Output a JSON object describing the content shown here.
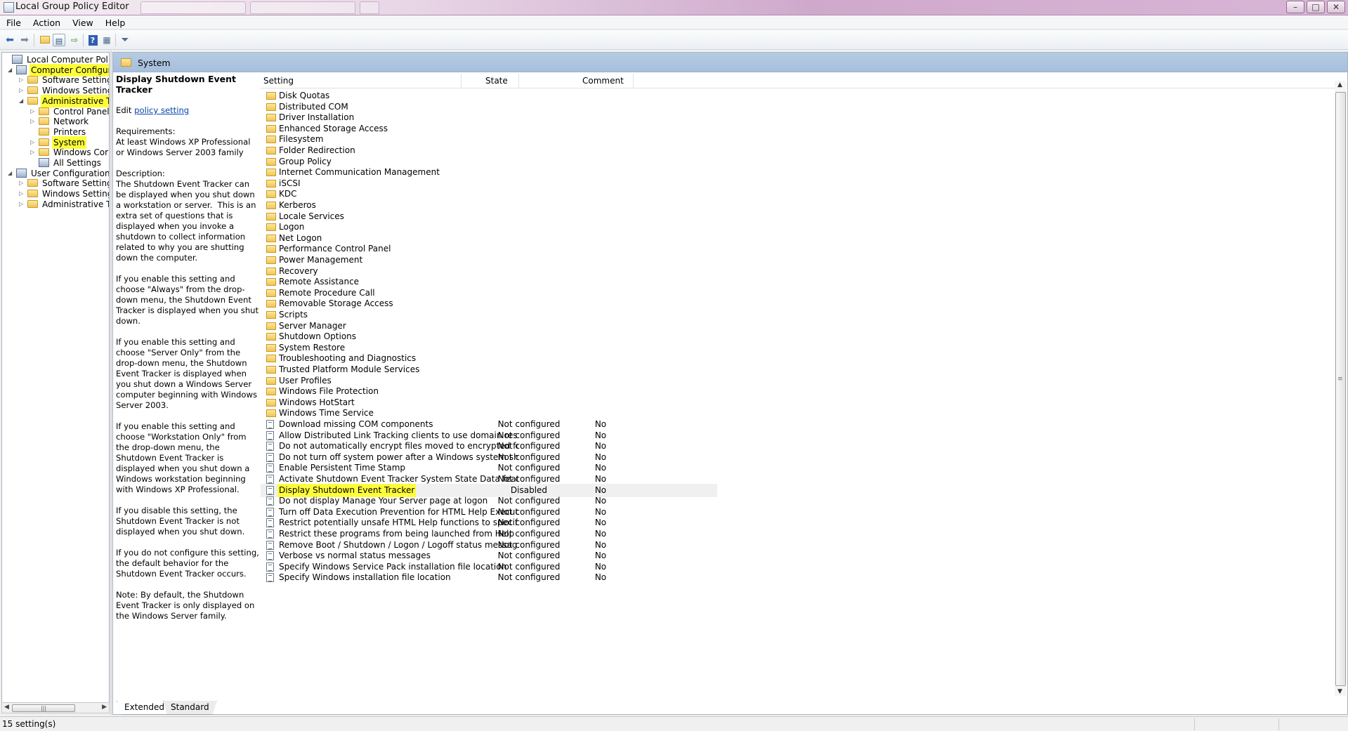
{
  "window": {
    "title": "Local Group Policy Editor",
    "controls": {
      "minimize": "–",
      "maximize": "□",
      "close": "✕"
    }
  },
  "menu": [
    "File",
    "Action",
    "View",
    "Help"
  ],
  "toolbar": {
    "icons": [
      "back-arrow-icon",
      "forward-arrow-icon",
      "up-folder-icon",
      "show-hide-tree-icon",
      "export-list-icon",
      "help-icon",
      "extended-view-icon",
      "filter-icon"
    ]
  },
  "tree": {
    "items": [
      {
        "label": "Local Computer Policy",
        "level": 0,
        "icon": "policy-icon",
        "twisty": "",
        "highlight": false
      },
      {
        "label": "Computer Configura",
        "level": 1,
        "icon": "computer-icon",
        "twisty": "◢",
        "highlight": true
      },
      {
        "label": "Software Settings",
        "level": 2,
        "icon": "folder-icon",
        "twisty": "▷",
        "highlight": false
      },
      {
        "label": "Windows Setting",
        "level": 2,
        "icon": "folder-icon",
        "twisty": "▷",
        "highlight": false
      },
      {
        "label": "Administrative Te",
        "level": 2,
        "icon": "folder-icon",
        "twisty": "◢",
        "highlight": true
      },
      {
        "label": "Control Panel",
        "level": 3,
        "icon": "folder-icon",
        "twisty": "▷",
        "highlight": false
      },
      {
        "label": "Network",
        "level": 3,
        "icon": "folder-icon",
        "twisty": "▷",
        "highlight": false
      },
      {
        "label": "Printers",
        "level": 3,
        "icon": "folder-icon",
        "twisty": "",
        "highlight": false
      },
      {
        "label": "System",
        "level": 3,
        "icon": "folder-icon",
        "twisty": "▷",
        "highlight": true
      },
      {
        "label": "Windows Cor",
        "level": 3,
        "icon": "folder-icon",
        "twisty": "▷",
        "highlight": false
      },
      {
        "label": "All Settings",
        "level": 3,
        "icon": "all-settings-icon",
        "twisty": "",
        "highlight": false
      },
      {
        "label": "User Configuration",
        "level": 1,
        "icon": "user-icon",
        "twisty": "◢",
        "highlight": false
      },
      {
        "label": "Software Settings",
        "level": 2,
        "icon": "folder-icon",
        "twisty": "▷",
        "highlight": false
      },
      {
        "label": "Windows Setting",
        "level": 2,
        "icon": "folder-icon",
        "twisty": "▷",
        "highlight": false
      },
      {
        "label": "Administrative Te",
        "level": 2,
        "icon": "folder-icon",
        "twisty": "▷",
        "highlight": false
      }
    ]
  },
  "content": {
    "header": "System",
    "description": {
      "title": "Display Shutdown Event Tracker",
      "edit_prefix": "Edit ",
      "edit_link": "policy setting",
      "paragraphs": [
        "Requirements:\nAt least Windows XP Professional or Windows Server 2003 family",
        "Description:\nThe Shutdown Event Tracker can be displayed when you shut down a workstation or server.  This is an extra set of questions that is displayed when you invoke a shutdown to collect information related to why you are shutting down the computer.",
        "If you enable this setting and choose \"Always\" from the drop-down menu, the Shutdown Event Tracker is displayed when you shut down.",
        "If you enable this setting and choose \"Server Only\" from the drop-down menu, the Shutdown Event Tracker is displayed when you shut down a Windows Server computer beginning with Windows Server 2003.",
        "If you enable this setting and choose \"Workstation Only\" from the drop-down menu, the Shutdown Event Tracker is displayed when you shut down a Windows workstation beginning with Windows XP Professional.",
        "If you disable this setting, the Shutdown Event Tracker is not displayed when you shut down.",
        "If you do not configure this setting, the default behavior for the Shutdown Event Tracker occurs.",
        "Note: By default, the Shutdown Event Tracker is only displayed on the Windows Server family."
      ]
    },
    "columns": {
      "setting": "Setting",
      "state": "State",
      "comment": "Comment"
    },
    "folders": [
      "Disk Quotas",
      "Distributed COM",
      "Driver Installation",
      "Enhanced Storage Access",
      "Filesystem",
      "Folder Redirection",
      "Group Policy",
      "Internet Communication Management",
      "iSCSI",
      "KDC",
      "Kerberos",
      "Locale Services",
      "Logon",
      "Net Logon",
      "Performance Control Panel",
      "Power Management",
      "Recovery",
      "Remote Assistance",
      "Remote Procedure Call",
      "Removable Storage Access",
      "Scripts",
      "Server Manager",
      "Shutdown Options",
      "System Restore",
      "Troubleshooting and Diagnostics",
      "Trusted Platform Module Services",
      "User Profiles",
      "Windows File Protection",
      "Windows HotStart",
      "Windows Time Service"
    ],
    "settings": [
      {
        "name": "Download missing COM components",
        "state": "Not configured",
        "comment": "No",
        "selected": false
      },
      {
        "name": "Allow Distributed Link Tracking clients to use domain resour...",
        "state": "Not configured",
        "comment": "No",
        "selected": false
      },
      {
        "name": "Do not automatically encrypt files moved to encrypted fold...",
        "state": "Not configured",
        "comment": "No",
        "selected": false
      },
      {
        "name": "Do not turn off system power after a Windows system shutd...",
        "state": "Not configured",
        "comment": "No",
        "selected": false
      },
      {
        "name": "Enable Persistent Time Stamp",
        "state": "Not configured",
        "comment": "No",
        "selected": false
      },
      {
        "name": "Activate Shutdown Event Tracker System State Data feature",
        "state": "Not configured",
        "comment": "No",
        "selected": false
      },
      {
        "name": "Display Shutdown Event Tracker",
        "state": "Disabled",
        "comment": "No",
        "selected": true
      },
      {
        "name": "Do not display Manage Your Server page at logon",
        "state": "Not configured",
        "comment": "No",
        "selected": false
      },
      {
        "name": "Turn off Data Execution Prevention for HTML Help Executible",
        "state": "Not configured",
        "comment": "No",
        "selected": false
      },
      {
        "name": "Restrict potentially unsafe HTML Help functions to specified...",
        "state": "Not configured",
        "comment": "No",
        "selected": false
      },
      {
        "name": "Restrict these programs from being launched from Help",
        "state": "Not configured",
        "comment": "No",
        "selected": false
      },
      {
        "name": "Remove Boot / Shutdown / Logon / Logoff status messages",
        "state": "Not configured",
        "comment": "No",
        "selected": false
      },
      {
        "name": "Verbose vs normal status messages",
        "state": "Not configured",
        "comment": "No",
        "selected": false
      },
      {
        "name": "Specify Windows Service Pack installation file location",
        "state": "Not configured",
        "comment": "No",
        "selected": false
      },
      {
        "name": "Specify Windows installation file location",
        "state": "Not configured",
        "comment": "No",
        "selected": false
      }
    ]
  },
  "view_tabs": [
    "Extended",
    "Standard"
  ],
  "status": "15 setting(s)",
  "colors": {
    "highlight": "#fdfd3a",
    "header_band": "#a6bfdc",
    "link": "#0645ad"
  }
}
